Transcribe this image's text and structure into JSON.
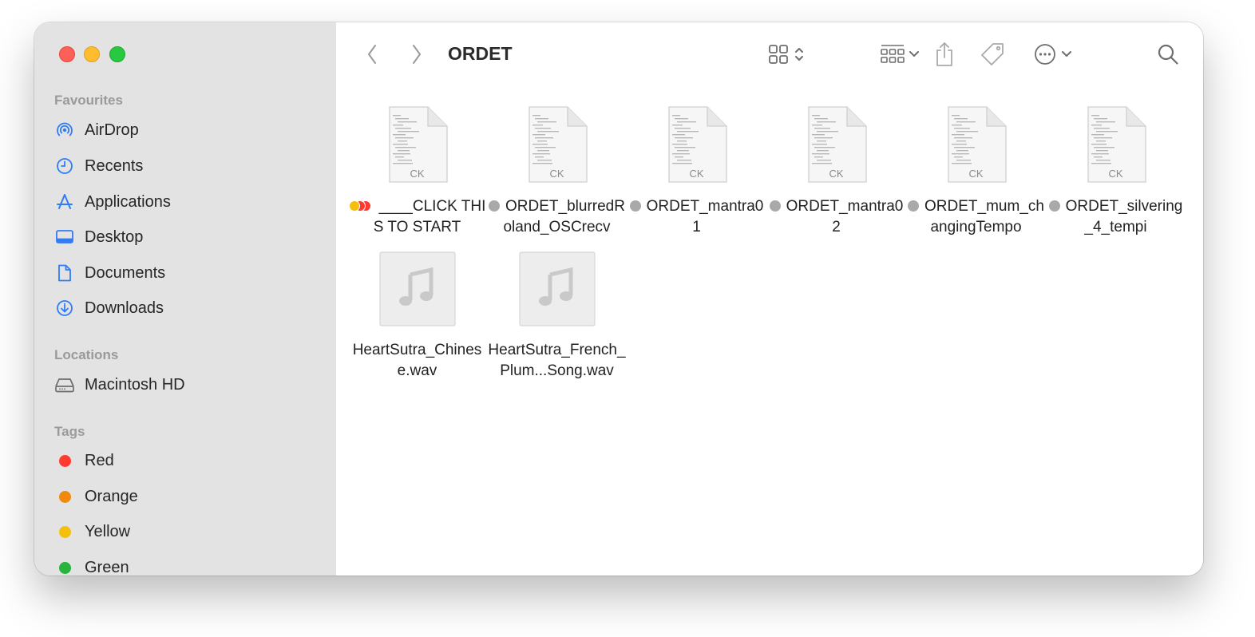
{
  "window": {
    "title": "ORDET"
  },
  "sidebar": {
    "favourites_title": "Favourites",
    "favourites": [
      {
        "label": "AirDrop",
        "icon": "airdrop-icon"
      },
      {
        "label": "Recents",
        "icon": "clock-icon"
      },
      {
        "label": "Applications",
        "icon": "applications-icon"
      },
      {
        "label": "Desktop",
        "icon": "desktop-icon"
      },
      {
        "label": "Documents",
        "icon": "document-icon"
      },
      {
        "label": "Downloads",
        "icon": "download-icon"
      }
    ],
    "locations_title": "Locations",
    "locations": [
      {
        "label": "Macintosh HD",
        "icon": "hard-drive-icon"
      }
    ],
    "tags_title": "Tags",
    "tags": [
      {
        "label": "Red",
        "color": "#ff3b30"
      },
      {
        "label": "Orange",
        "color": "#f08a0e"
      },
      {
        "label": "Yellow",
        "color": "#f5c00c"
      },
      {
        "label": "Green",
        "color": "#28b33c"
      }
    ]
  },
  "files": [
    {
      "name": "____CLICK THIS TO START",
      "kind": "ck",
      "thumb_label": "CK",
      "tags": [
        "#f5c00c",
        "#ff3b30",
        "#ff3b30"
      ]
    },
    {
      "name": "ORDET_blurredRoland_OSCrecv",
      "kind": "ck",
      "thumb_label": "CK",
      "tags": [
        "#a9a9a9"
      ]
    },
    {
      "name": "ORDET_mantra01",
      "kind": "ck",
      "thumb_label": "CK",
      "tags": [
        "#a9a9a9"
      ]
    },
    {
      "name": "ORDET_mantra02",
      "kind": "ck",
      "thumb_label": "CK",
      "tags": [
        "#a9a9a9"
      ]
    },
    {
      "name": "ORDET_mum_changingTempo",
      "kind": "ck",
      "thumb_label": "CK",
      "tags": [
        "#a9a9a9"
      ]
    },
    {
      "name": "ORDET_silvering_4_tempi",
      "kind": "ck",
      "thumb_label": "CK",
      "tags": [
        "#a9a9a9"
      ]
    },
    {
      "name": "HeartSutra_Chinese.wav",
      "kind": "audio",
      "thumb_label": "",
      "tags": []
    },
    {
      "name": "HeartSutra_French_Plum...Song.wav",
      "kind": "audio",
      "thumb_label": "",
      "tags": []
    }
  ],
  "colors": {
    "accent": "#2f7cf6",
    "sidebar_bg": "#e3e3e3",
    "toolbar_icon": "#6e6e6e"
  }
}
